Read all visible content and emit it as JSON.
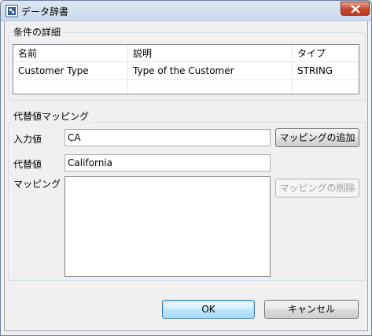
{
  "window": {
    "title": "データ辞書"
  },
  "condition_group": {
    "label": "条件の詳細"
  },
  "table": {
    "columns": [
      "名前",
      "説明",
      "タイプ"
    ],
    "rows": [
      [
        "Customer Type",
        "Type of the Customer",
        "STRING"
      ]
    ]
  },
  "mapping_group": {
    "label": "代替値マッピング"
  },
  "fields": {
    "input_label": "入力値",
    "input_value": "CA",
    "alt_label": "代替値",
    "alt_value": "California",
    "mapping_label": "マッピング"
  },
  "buttons": {
    "add_mapping": "マッピングの追加",
    "delete_mapping": "マッピングの削除",
    "ok": "OK",
    "cancel": "キャンセル"
  }
}
